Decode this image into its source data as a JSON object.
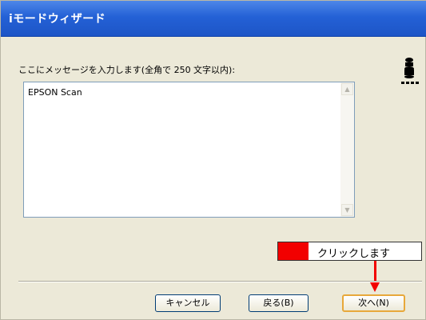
{
  "window": {
    "title": "iモードウィザード"
  },
  "form": {
    "prompt": "ここにメッセージを入力します(全角で 250 文字以内):",
    "message_value": "EPSON Scan"
  },
  "annotation": {
    "text": "クリックします",
    "color": "#f20000"
  },
  "buttons": {
    "cancel": "キャンセル",
    "back": "戻る(B)",
    "next": "次へ(N)"
  },
  "icons": {
    "logo": "scanner-icon",
    "scroll_up": "scroll-up-arrow-icon",
    "scroll_down": "scroll-down-arrow-icon",
    "pointer": "red-arrow-icon"
  }
}
